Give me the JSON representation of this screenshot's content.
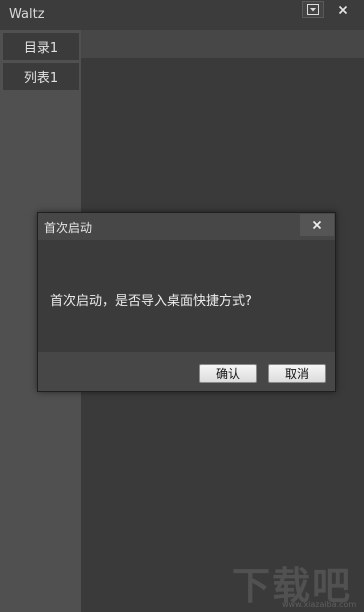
{
  "app": {
    "title": "Waltz"
  },
  "window_controls": {
    "menu_icon": "dropdown-icon",
    "close_icon": "close-icon"
  },
  "sidebar": {
    "items": [
      {
        "label": "目录1"
      },
      {
        "label": "列表1"
      }
    ]
  },
  "dialog": {
    "title": "首次启动",
    "message": "首次启动，是否导入桌面快捷方式?",
    "ok_label": "确认",
    "cancel_label": "取消",
    "close_icon": "close-icon"
  },
  "watermark": {
    "text": "下载吧",
    "url": "www.xiazaiba.com"
  }
}
